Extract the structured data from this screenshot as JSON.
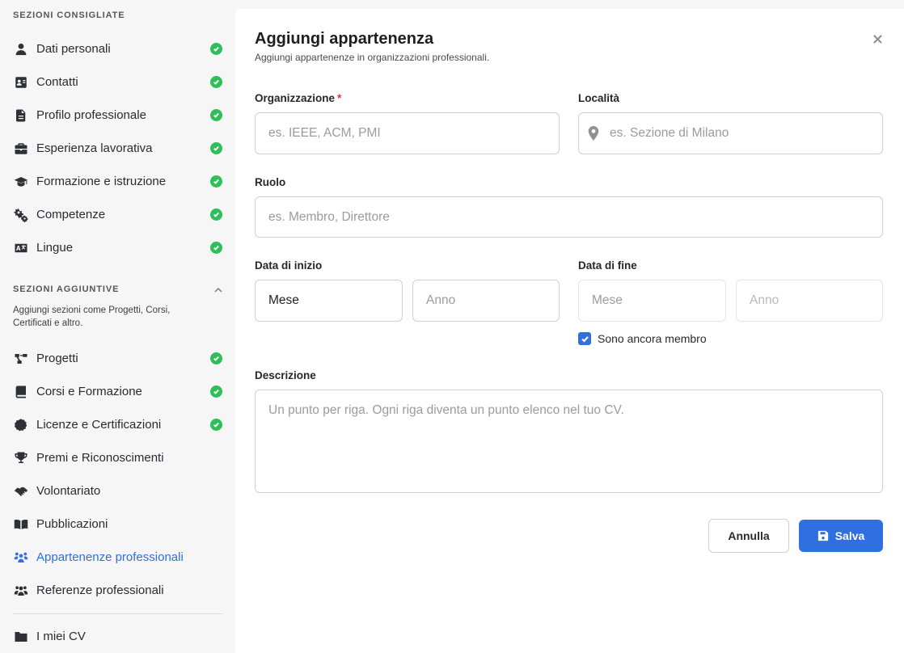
{
  "sidebar": {
    "recommended_title": "SEZIONI CONSIGLIATE",
    "recommended": [
      {
        "label": "Dati personali",
        "icon": "user-icon",
        "done": true
      },
      {
        "label": "Contatti",
        "icon": "address-card-icon",
        "done": true
      },
      {
        "label": "Profilo professionale",
        "icon": "document-icon",
        "done": true
      },
      {
        "label": "Esperienza lavorativa",
        "icon": "briefcase-icon",
        "done": true
      },
      {
        "label": "Formazione e istruzione",
        "icon": "graduation-cap-icon",
        "done": true
      },
      {
        "label": "Competenze",
        "icon": "gears-icon",
        "done": true
      },
      {
        "label": "Lingue",
        "icon": "language-icon",
        "done": true
      }
    ],
    "additional_title": "SEZIONI AGGIUNTIVE",
    "additional_description": "Aggiungi sezioni come Progetti, Corsi, Certificati e altro.",
    "additional": [
      {
        "label": "Progetti",
        "icon": "diagram-icon",
        "done": true
      },
      {
        "label": "Corsi e Formazione",
        "icon": "book-icon",
        "done": true
      },
      {
        "label": "Licenze e Certificazioni",
        "icon": "certificate-icon",
        "done": true
      },
      {
        "label": "Premi e Riconoscimenti",
        "icon": "trophy-icon",
        "done": false
      },
      {
        "label": "Volontariato",
        "icon": "handshake-icon",
        "done": false
      },
      {
        "label": "Pubblicazioni",
        "icon": "open-book-icon",
        "done": false
      },
      {
        "label": "Appartenenze professionali",
        "icon": "people-group-icon",
        "done": false,
        "active": true
      },
      {
        "label": "Referenze professionali",
        "icon": "users-icon",
        "done": false
      }
    ],
    "my_cvs": {
      "label": "I miei CV",
      "icon": "folder-icon"
    }
  },
  "form": {
    "title": "Aggiungi appartenenza",
    "subtitle": "Aggiungi appartenenze in organizzazioni professionali.",
    "organization": {
      "label": "Organizzazione",
      "required_mark": "*",
      "placeholder": "es. IEEE, ACM, PMI",
      "value": ""
    },
    "location": {
      "label": "Località",
      "placeholder": "es. Sezione di Milano",
      "value": ""
    },
    "role": {
      "label": "Ruolo",
      "placeholder": "es. Membro, Direttore",
      "value": ""
    },
    "start_date": {
      "label": "Data di inizio",
      "month": "Mese",
      "year_placeholder": "Anno"
    },
    "end_date": {
      "label": "Data di fine",
      "month_placeholder": "Mese",
      "year_placeholder": "Anno"
    },
    "still_member": {
      "label": "Sono ancora membro",
      "checked": true
    },
    "description": {
      "label": "Descrizione",
      "placeholder": "Un punto per riga. Ogni riga diventa un punto elenco nel tuo CV."
    },
    "cancel_label": "Annulla",
    "save_label": "Salva"
  },
  "colors": {
    "accent": "#2f6fe0",
    "success": "#2fbe5a",
    "required": "#e0353f"
  }
}
